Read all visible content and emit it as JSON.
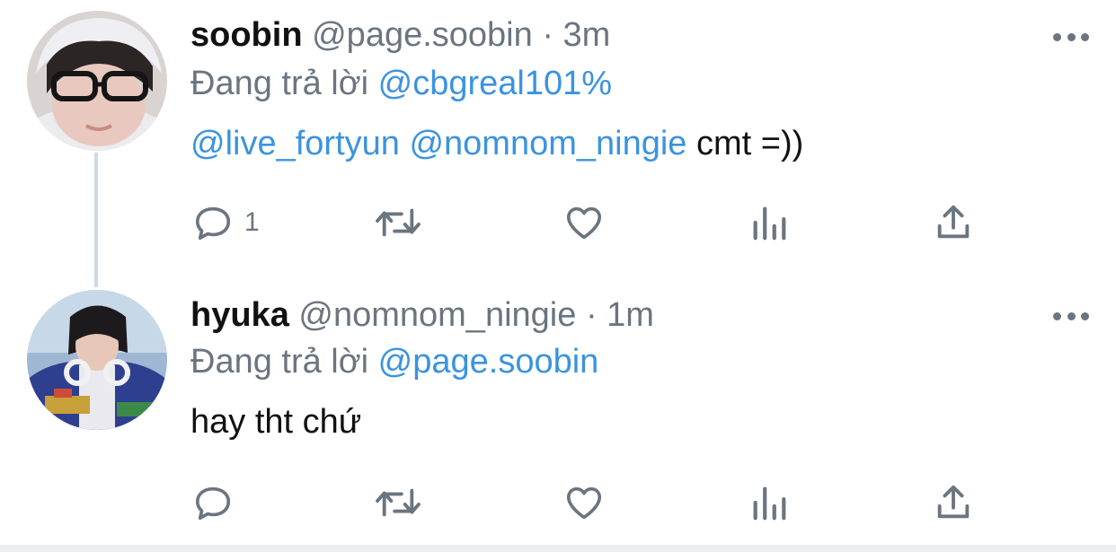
{
  "tweets": [
    {
      "name": "soobin",
      "handle": "@page.soobin",
      "separator": "·",
      "time": "3m",
      "reply_prefix": "Đang trả lời",
      "reply_to": "@cbgreal101%",
      "body": {
        "mention1": "@live_fortyun",
        "mention2": "@nomnom_ningie",
        "text": "cmt =))"
      },
      "reply_count": "1"
    },
    {
      "name": "hyuka",
      "handle": "@nomnom_ningie",
      "separator": "·",
      "time": "1m",
      "reply_prefix": "Đang trả lời",
      "reply_to": "@page.soobin",
      "body": {
        "text": "hay tht chứ"
      },
      "reply_count": ""
    }
  ],
  "icons": [
    "reply-icon",
    "retweet-icon",
    "like-icon",
    "views-icon",
    "share-icon",
    "more-icon"
  ],
  "colors": {
    "text": "#111111",
    "muted": "#6b7580",
    "link": "#3b93e0",
    "thread_line": "#cfd9de"
  }
}
